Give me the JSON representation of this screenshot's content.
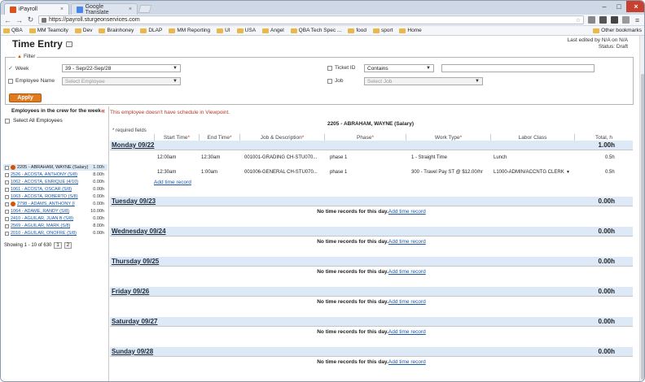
{
  "browser": {
    "tabs": [
      {
        "label": "iPayroll",
        "active": true
      },
      {
        "label": "Google Translate",
        "active": false
      }
    ],
    "url": "https://payroll.sturgeonservices.com",
    "bookmarks": [
      "QBA",
      "MM Teamcity",
      "Dev",
      "Brainhoney",
      "DLAP",
      "MM Reporting",
      "UI",
      "USA",
      "Angel",
      "QBA Tech Spec ...",
      "food",
      "sport",
      "Home"
    ],
    "other_bookmarks": "Other bookmarks"
  },
  "page": {
    "title": "Time Entry",
    "last_edited": "Last edited by N/A on N/A",
    "status": "Status: Draft"
  },
  "filter": {
    "legend": "Filter",
    "week_label": "Week",
    "week_value": "39 - Sep/22-Sep/28",
    "employee_label": "Employee Name",
    "employee_placeholder": "Select Employee",
    "ticket_label": "Ticket ID",
    "ticket_op": "Contains",
    "job_label": "Job",
    "job_placeholder": "Select Job",
    "apply_label": "Apply"
  },
  "crew": {
    "title": "Employees in the crew for the week",
    "select_all": "Select All Employees",
    "employees": [
      {
        "name": "2205 - ABRAHAM, WAYNE (Salary)",
        "hours": "1.00h",
        "selected": true,
        "warn": true
      },
      {
        "name": "2526 - ACOSTA, ANTHONY (S/8)",
        "hours": "8.00h",
        "selected": false,
        "warn": false
      },
      {
        "name": "1062 - ACOSTA, ENRIQUE (4/10)",
        "hours": "0.00h",
        "selected": false,
        "warn": false
      },
      {
        "name": "1061 - ACOSTA, OSCAR (S/8)",
        "hours": "0.00h",
        "selected": false,
        "warn": false
      },
      {
        "name": "1063 - ACOSTA, ROBERTO (S/8)",
        "hours": "0.00h",
        "selected": false,
        "warn": false
      },
      {
        "name": "2798 - ADAMS, ANTHONY (I",
        "hours": "0.00h",
        "selected": false,
        "warn": true
      },
      {
        "name": "1064 - ADAME, RANDY (S/8)",
        "hours": "10.00h",
        "selected": false,
        "warn": false
      },
      {
        "name": "2410 - AGUILAR, JUAN B (S/8)",
        "hours": "0.00h",
        "selected": false,
        "warn": false
      },
      {
        "name": "2569 - AGUILAR, MARK (S/8)",
        "hours": "8.00h",
        "selected": false,
        "warn": false
      },
      {
        "name": "2010 - AGUILAR, ONOFRE (S/8)",
        "hours": "0.00h",
        "selected": false,
        "warn": false
      }
    ],
    "paging": "Showing 1 - 10 of 630",
    "pages": [
      "1",
      "2"
    ]
  },
  "timesheet": {
    "warning": "This employee doesn't have schedule in Viewpoint.",
    "employee": "2205 - ABRAHAM, WAYNE (Salary)",
    "required": "* required fields",
    "columns": [
      {
        "label": "Start Time",
        "req": "*"
      },
      {
        "label": "End Time",
        "req": "*"
      },
      {
        "label": "Job & Description",
        "req": "*"
      },
      {
        "label": "Phase",
        "req": "*"
      },
      {
        "label": "Work Type",
        "req": "*"
      },
      {
        "label": "Labor Class",
        "req": ""
      },
      {
        "label": "Total, h",
        "req": ""
      }
    ],
    "monday": {
      "name": "Monday 09/22",
      "total": "1.00h",
      "rows": [
        {
          "start": "12:00am",
          "end": "12:30am",
          "job": "001001-GRADING CH-STU070...",
          "phase": "phase 1",
          "work_type": "1 - Straight Time",
          "labor_class": "Lunch",
          "total": "0.5h"
        },
        {
          "start": "12:30am",
          "end": "1:00am",
          "job": "001006-GENERAL CH-STU070...",
          "phase": "phase 1",
          "work_type": "300 - Travel Pay ST @ $12.00/hr",
          "labor_class": "L1000-ADMIN/ACCNTG CLERK",
          "total": "0.5h"
        }
      ],
      "add_label": "Add time record"
    },
    "no_records": "No time records for this day.",
    "add_label": "Add time record",
    "days": [
      {
        "name": "Tuesday 09/23",
        "total": "0.00h"
      },
      {
        "name": "Wednesday 09/24",
        "total": "0.00h"
      },
      {
        "name": "Thursday 09/25",
        "total": "0.00h"
      },
      {
        "name": "Friday 09/26",
        "total": "0.00h"
      },
      {
        "name": "Saturday 09/27",
        "total": "0.00h"
      },
      {
        "name": "Sunday 09/28",
        "total": "0.00h"
      }
    ]
  },
  "colors": {
    "accent": "#e07a1f",
    "link": "#1a56a6",
    "daybar": "#dde9f6",
    "warning": "#b03a2e"
  }
}
